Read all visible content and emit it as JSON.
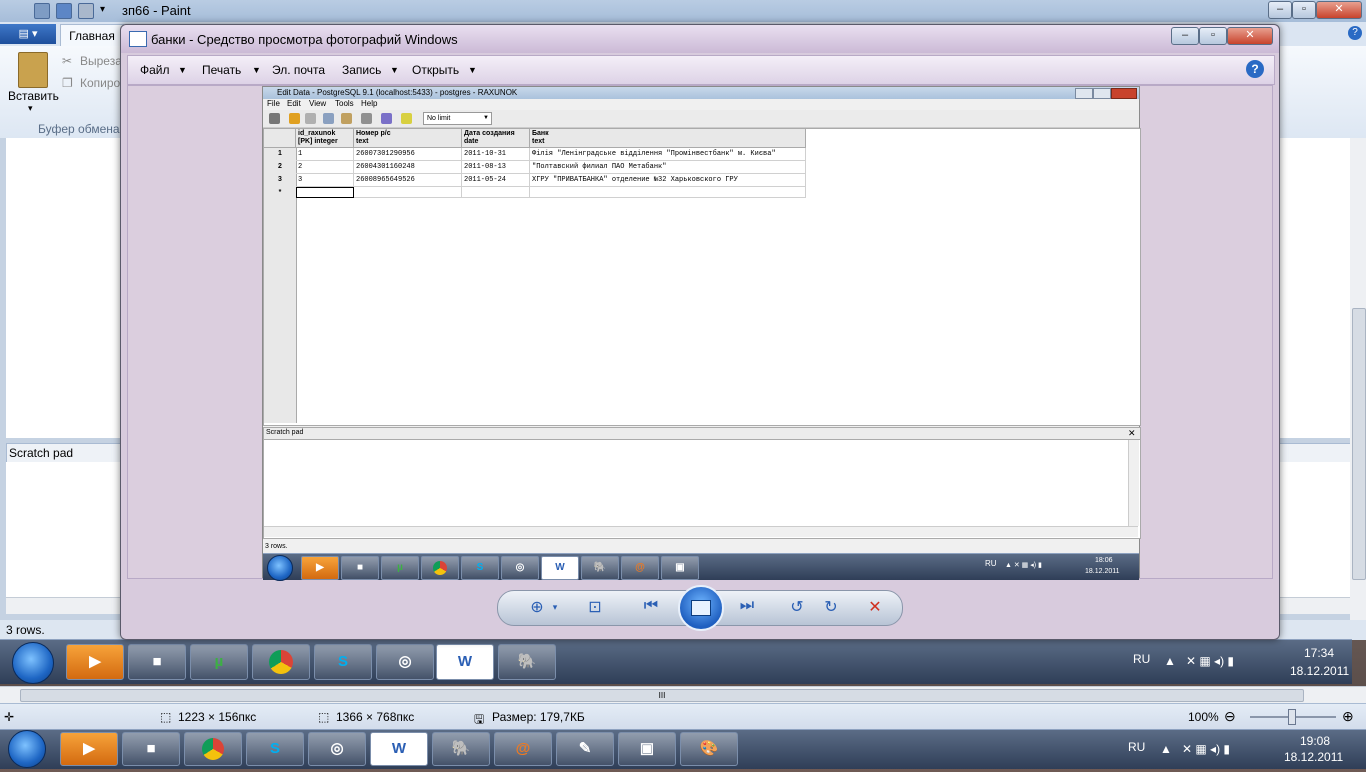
{
  "paint": {
    "title": "зп66 - Paint",
    "file_btn": "▤ ▾",
    "home_tab": "Главная",
    "cut_label": "Вырезат",
    "copy_label": "Копиро",
    "paste_label": "Вставить",
    "clipboard_group": "Буфер обмена",
    "scratch_pad": "Scratch pad",
    "rows_status": "3 rows.",
    "status_selection": "1223 × 156пкс",
    "status_image": "1366 × 768пкс",
    "status_size": "Размер: 179,7КБ",
    "zoom": "100%",
    "scroll_marker": "III"
  },
  "viewer": {
    "title": "банки - Средство просмотра фотографий Windows",
    "menu": [
      "Файл",
      "Печать",
      "Эл. почта",
      "Запись",
      "Открыть"
    ],
    "help": "?"
  },
  "pgadmin": {
    "title": "Edit Data - PostgreSQL 9.1 (localhost:5433) - postgres - RAXUNOK",
    "menu": [
      "File",
      "Edit",
      "View",
      "Tools",
      "Help"
    ],
    "limit": "No limit",
    "columns": [
      {
        "name": "id_raxunok",
        "type": "[PK] integer"
      },
      {
        "name": "Номер р/с",
        "type": "text"
      },
      {
        "name": "Дата создания",
        "type": "date"
      },
      {
        "name": "Банк",
        "type": "text"
      }
    ],
    "rows": [
      {
        "num": "1",
        "id": "1",
        "account": "26007301290956",
        "date": "2011-10-31",
        "bank": "Філія \"Ленінградське відділення \"Промінвестбанк\" м. Києва\""
      },
      {
        "num": "2",
        "id": "2",
        "account": "26004301160248",
        "date": "2011-08-13",
        "bank": "\"Полтавский филиал ПАО Метабанк\""
      },
      {
        "num": "3",
        "id": "3",
        "account": "26008965649526",
        "date": "2011-05-24",
        "bank": "ХГРУ \"ПРИВАТБАНКА\" отделение №32 Харьковского ГРУ"
      }
    ],
    "new_row": "*",
    "scratch_pad": "Scratch pad",
    "status": "3 rows.",
    "tray_lang": "RU",
    "time": "18:06",
    "date": "18.12.2011"
  },
  "taskbar_mid": {
    "lang": "RU",
    "time": "17:34",
    "date": "18.12.2011"
  },
  "taskbar_bottom": {
    "lang": "RU",
    "time": "19:08",
    "date": "18.12.2011"
  },
  "icons": {
    "word": "W",
    "utorrent": "µ",
    "skype": "S"
  }
}
